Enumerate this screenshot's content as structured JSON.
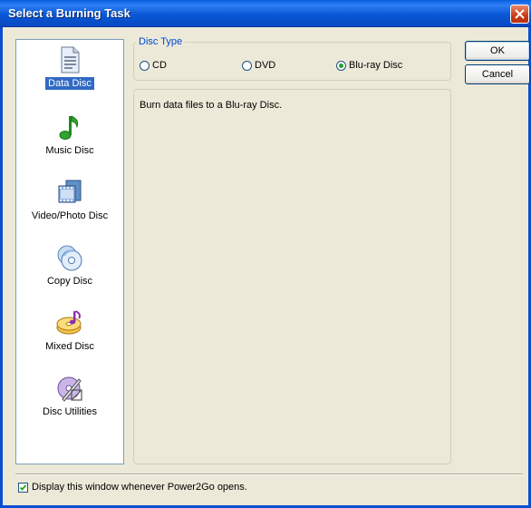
{
  "window": {
    "title": "Select a Burning Task"
  },
  "tasks": [
    {
      "label": "Data Disc",
      "icon": "document-icon",
      "selected": true
    },
    {
      "label": "Music Disc",
      "icon": "music-note-icon",
      "selected": false
    },
    {
      "label": "Video/Photo Disc",
      "icon": "film-strip-icon",
      "selected": false
    },
    {
      "label": "Copy Disc",
      "icon": "copy-disc-icon",
      "selected": false
    },
    {
      "label": "Mixed Disc",
      "icon": "mixed-disc-icon",
      "selected": false
    },
    {
      "label": "Disc Utilities",
      "icon": "disc-utilities-icon",
      "selected": false
    }
  ],
  "disc_type": {
    "legend": "Disc Type",
    "options": [
      {
        "label": "CD",
        "checked": false
      },
      {
        "label": "DVD",
        "checked": false
      },
      {
        "label": "Blu-ray Disc",
        "checked": true
      }
    ]
  },
  "description": "Burn data files to a Blu-ray Disc.",
  "buttons": {
    "ok": "OK",
    "cancel": "Cancel"
  },
  "footer": {
    "checkbox_label": "Display this window whenever Power2Go opens.",
    "checked": true
  },
  "colors": {
    "title_bar": "#0a5fe0",
    "selection": "#316ac5",
    "legend_text": "#0046d5",
    "radio_dot": "#21a121"
  }
}
